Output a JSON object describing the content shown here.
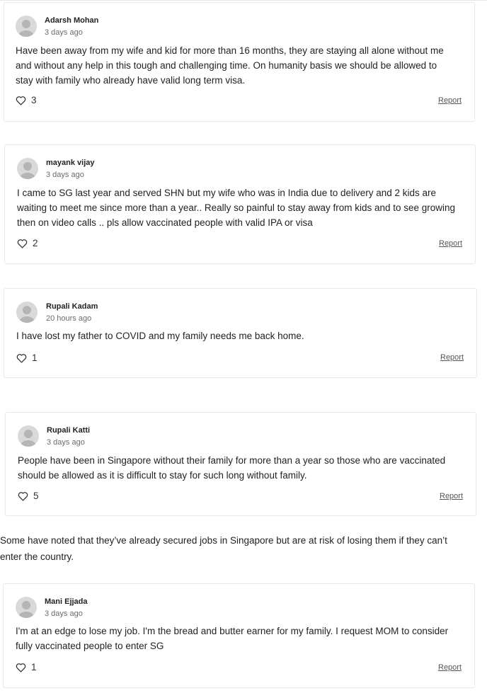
{
  "comments": [
    {
      "author": "Adarsh Mohan",
      "time": "3 days ago",
      "text_lines": [
        "Have been away from my wife and kid for more than 16 months, they are staying all alone without me",
        "and without any help in this tough and challenging time. On humanity basis we should be allowed to",
        "stay with family who already have valid long term visa."
      ],
      "likes": "3",
      "report": "Report"
    },
    {
      "author": "mayank vijay",
      "time": "3 days ago",
      "text_lines": [
        "I came to SG last year and served SHN but my wife who was in India due to delivery and 2 kids are",
        "waiting to meet me since more than a year.. Really so painful to stay away from kids and to see growing",
        "then on video calls .. pls allow vaccinated people with valid IPA or visa"
      ],
      "likes": "2",
      "report": "Report"
    },
    {
      "author": "Rupali Kadam",
      "time": "20 hours ago",
      "text_lines": [
        "I have lost my father to COVID and my family needs me back home."
      ],
      "likes": "1",
      "report": "Report"
    },
    {
      "author": "Rupali Katti",
      "time": "3 days ago",
      "text_lines": [
        "People have been in Singapore without their family for more than a year so those who are vaccinated",
        "should be allowed as it is difficult to stay for such long without family."
      ],
      "likes": "5",
      "report": "Report"
    },
    {
      "author": "Mani Ejjada",
      "time": "3 days ago",
      "text_lines": [
        "I'm at an edge to lose my job. I'm the bread and butter earner for my family. I request MOM to consider",
        "fully vaccinated people to enter SG"
      ],
      "likes": "1",
      "report": "Report"
    }
  ],
  "article": {
    "paragraph_lines": [
      "Some have noted that they’ve already secured jobs in Singapore but are at risk of losing them if they can’t",
      "enter the country."
    ]
  },
  "icons": {
    "avatar": "default-user-icon",
    "like": "heart-outline-icon"
  }
}
